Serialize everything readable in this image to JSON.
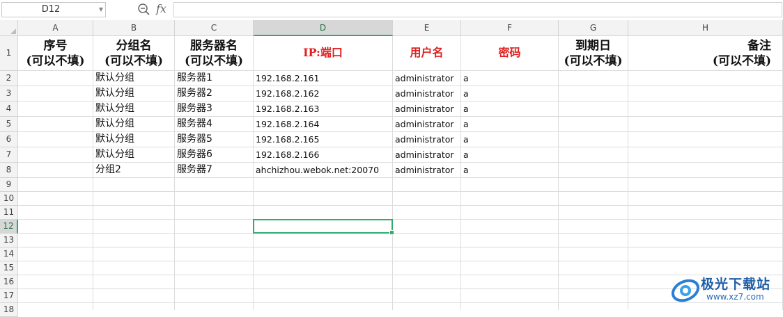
{
  "formula_bar": {
    "name_box": "D12",
    "zoom_icon": "zoom-out-icon",
    "fx_label": "fx",
    "formula_value": ""
  },
  "columns": [
    {
      "id": "A",
      "label": "A"
    },
    {
      "id": "B",
      "label": "B"
    },
    {
      "id": "C",
      "label": "C"
    },
    {
      "id": "D",
      "label": "D"
    },
    {
      "id": "E",
      "label": "E"
    },
    {
      "id": "F",
      "label": "F"
    },
    {
      "id": "G",
      "label": "G"
    },
    {
      "id": "H",
      "label": "H"
    }
  ],
  "rows": [
    "1",
    "2",
    "3",
    "4",
    "5",
    "6",
    "7",
    "8",
    "9",
    "10",
    "11",
    "12",
    "13",
    "14",
    "15",
    "16",
    "17",
    "18"
  ],
  "header_row": {
    "A": "序号\n(可以不填)",
    "B": "分组名\n(可以不填)",
    "C": "服务器名\n(可以不填)",
    "D": "IP:端口",
    "E": "用户名",
    "F": "密码",
    "G": "到期日\n(可以不填)",
    "H": "备注\n(可以不填)"
  },
  "data_rows": [
    {
      "A": "",
      "B": "默认分组",
      "C": "服务器1",
      "D": "192.168.2.161",
      "E": "administrator",
      "F": "a",
      "G": "",
      "H": ""
    },
    {
      "A": "",
      "B": "默认分组",
      "C": "服务器2",
      "D": "192.168.2.162",
      "E": "administrator",
      "F": "a",
      "G": "",
      "H": ""
    },
    {
      "A": "",
      "B": "默认分组",
      "C": "服务器3",
      "D": "192.168.2.163",
      "E": "administrator",
      "F": "a",
      "G": "",
      "H": ""
    },
    {
      "A": "",
      "B": "默认分组",
      "C": "服务器4",
      "D": "192.168.2.164",
      "E": "administrator",
      "F": "a",
      "G": "",
      "H": ""
    },
    {
      "A": "",
      "B": "默认分组",
      "C": "服务器5",
      "D": "192.168.2.165",
      "E": "administrator",
      "F": "a",
      "G": "",
      "H": ""
    },
    {
      "A": "",
      "B": "默认分组",
      "C": "服务器6",
      "D": "192.168.2.166",
      "E": "administrator",
      "F": "a",
      "G": "",
      "H": ""
    },
    {
      "A": "",
      "B": "分组2",
      "C": "服务器7",
      "D": "ahchizhou.webok.net:20070",
      "E": "administrator",
      "F": "a",
      "G": "",
      "H": ""
    }
  ],
  "selection": {
    "cell": "D12",
    "column": "D",
    "row": "12"
  },
  "colors": {
    "accent": "#2eac6e",
    "header_red": "#e02020",
    "header_bg": "#f3f3f3",
    "grid_line": "#dcdcdc"
  },
  "watermark": {
    "name": "极光下载站",
    "url": "www.xz7.com"
  }
}
